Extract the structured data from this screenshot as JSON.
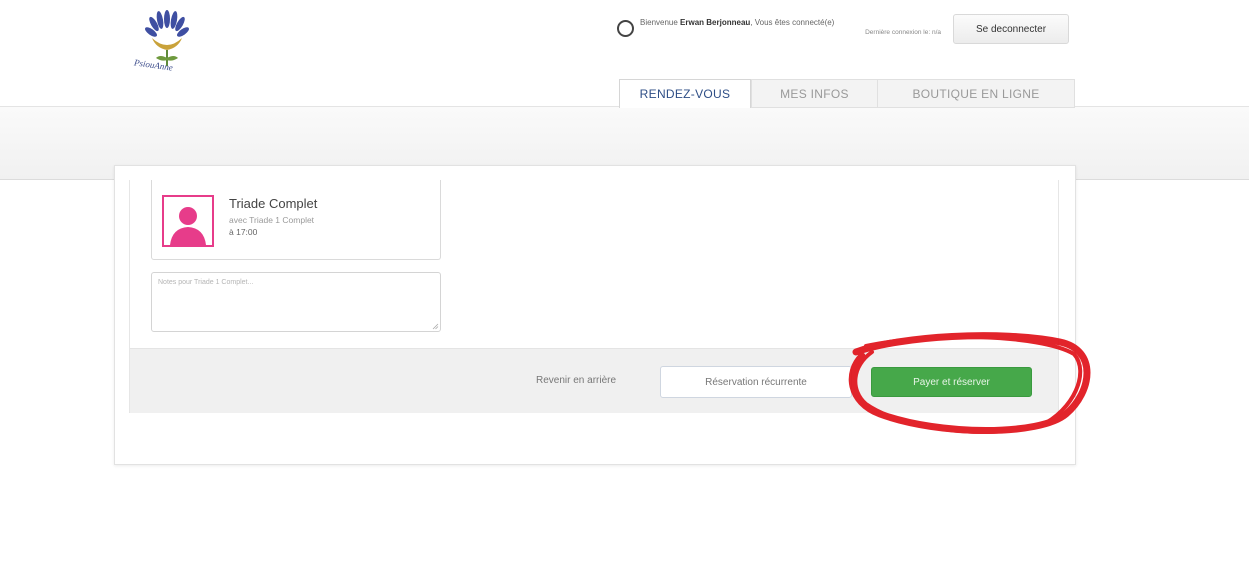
{
  "header": {
    "welcome_prefix": "Bienvenue",
    "user_name": "Erwan Berjonneau",
    "welcome_suffix": ", Vous êtes connecté(e)",
    "last_connection": "Dernière connexion le: n/a",
    "logout_label": "Se deconnecter",
    "logo_text": "PsiouAnne"
  },
  "tabs": [
    {
      "label": "RENDEZ-VOUS",
      "active": true
    },
    {
      "label": "MES INFOS",
      "active": false
    },
    {
      "label": "BOUTIQUE EN LIGNE",
      "active": false
    }
  ],
  "service": {
    "title": "Triade Complet",
    "with": "avec Triade 1 Complet",
    "time": "à 17:00",
    "avatar_icon": "user-avatar-icon"
  },
  "notes": {
    "placeholder": "Notes pour Triade 1 Complet..."
  },
  "actions": {
    "back_label": "Revenir en arrière",
    "recurring_label": "Réservation récurrente",
    "pay_label": "Payer et réserver"
  },
  "colors": {
    "accent_green": "#46a84a",
    "avatar_pink": "#e73c8a",
    "annotation_red": "#e0121a",
    "tab_active_text": "#2e4e86"
  }
}
